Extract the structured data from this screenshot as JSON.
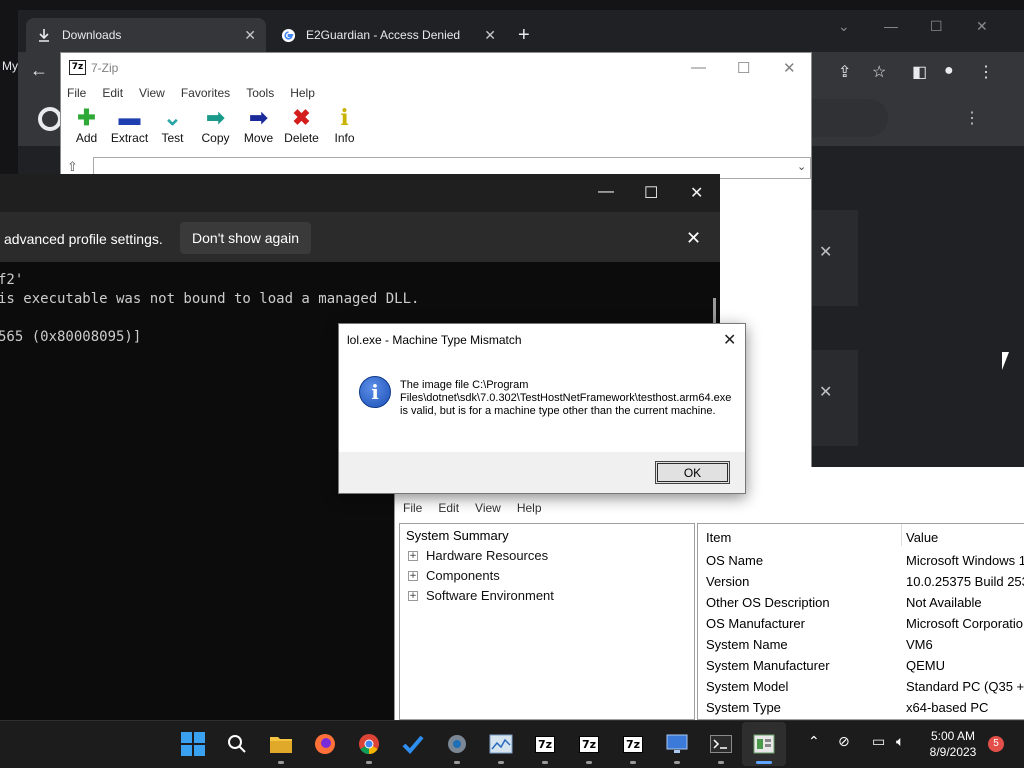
{
  "chrome": {
    "tabs": [
      {
        "label": "Downloads",
        "icon": "download-icon"
      },
      {
        "label": "E2Guardian - Access Denied",
        "icon": "google-icon"
      }
    ],
    "new_tab_label": "+",
    "partial_left_text": "My"
  },
  "sevenzip": {
    "title": "7-Zip",
    "icon_text": "7z",
    "menu": [
      "File",
      "Edit",
      "View",
      "Favorites",
      "Tools",
      "Help"
    ],
    "toolbar": [
      {
        "label": "Add",
        "icon": "plus-icon",
        "color": "#2ea836"
      },
      {
        "label": "Extract",
        "icon": "minus-icon",
        "color": "#1f3fb0"
      },
      {
        "label": "Test",
        "icon": "check-chevron-icon",
        "color": "#2aa6a6"
      },
      {
        "label": "Copy",
        "icon": "arrow-right-teal-icon",
        "color": "#1a9a8a"
      },
      {
        "label": "Move",
        "icon": "arrow-right-blue-icon",
        "color": "#1a2a9a"
      },
      {
        "label": "Delete",
        "icon": "x-red-icon",
        "color": "#d41e1e"
      },
      {
        "label": "Info",
        "icon": "info-yellow-icon",
        "color": "#c8b400"
      }
    ]
  },
  "terminal": {
    "banner_text": "advanced profile settings.",
    "dont_show_label": "Don't show again",
    "lines": [
      "f2'",
      "is executable was not bound to load a managed DLL.",
      "",
      "565 (0x80008095)]"
    ]
  },
  "dialog": {
    "title": "lol.exe - Machine Type Mismatch",
    "message": "The image file C:\\Program Files\\dotnet\\sdk\\7.0.302\\TestHostNetFramework\\testhost.arm64.exe is valid, but is for a machine type other than the current machine.",
    "ok_label": "OK"
  },
  "msinfo": {
    "menu": [
      "File",
      "Edit",
      "View",
      "Help"
    ],
    "tree_root": "System Summary",
    "tree_children": [
      "Hardware Resources",
      "Components",
      "Software Environment"
    ],
    "columns": {
      "item": "Item",
      "value": "Value"
    },
    "rows": [
      {
        "item": "OS Name",
        "value": "Microsoft Windows 1"
      },
      {
        "item": "Version",
        "value": "10.0.25375 Build 253"
      },
      {
        "item": "Other OS Description",
        "value": "Not Available"
      },
      {
        "item": "OS Manufacturer",
        "value": "Microsoft Corporatio"
      },
      {
        "item": "System Name",
        "value": "VM6"
      },
      {
        "item": "System Manufacturer",
        "value": "QEMU"
      },
      {
        "item": "System Model",
        "value": "Standard PC (Q35 +"
      },
      {
        "item": "System Type",
        "value": "x64-based PC"
      }
    ]
  },
  "taskbar": {
    "time": "5:00 AM",
    "date": "8/9/2023",
    "notification_count": "5",
    "apps": [
      "start-icon",
      "search-icon",
      "file-explorer-icon",
      "firefox-icon",
      "chrome-icon",
      "todo-icon",
      "settings-icon",
      "resource-monitor-icon",
      "7zip-icon",
      "7zip-icon",
      "7zip-icon",
      "remote-desktop-icon",
      "terminal-icon",
      "system-info-icon"
    ],
    "app_label_7z": "7z"
  }
}
